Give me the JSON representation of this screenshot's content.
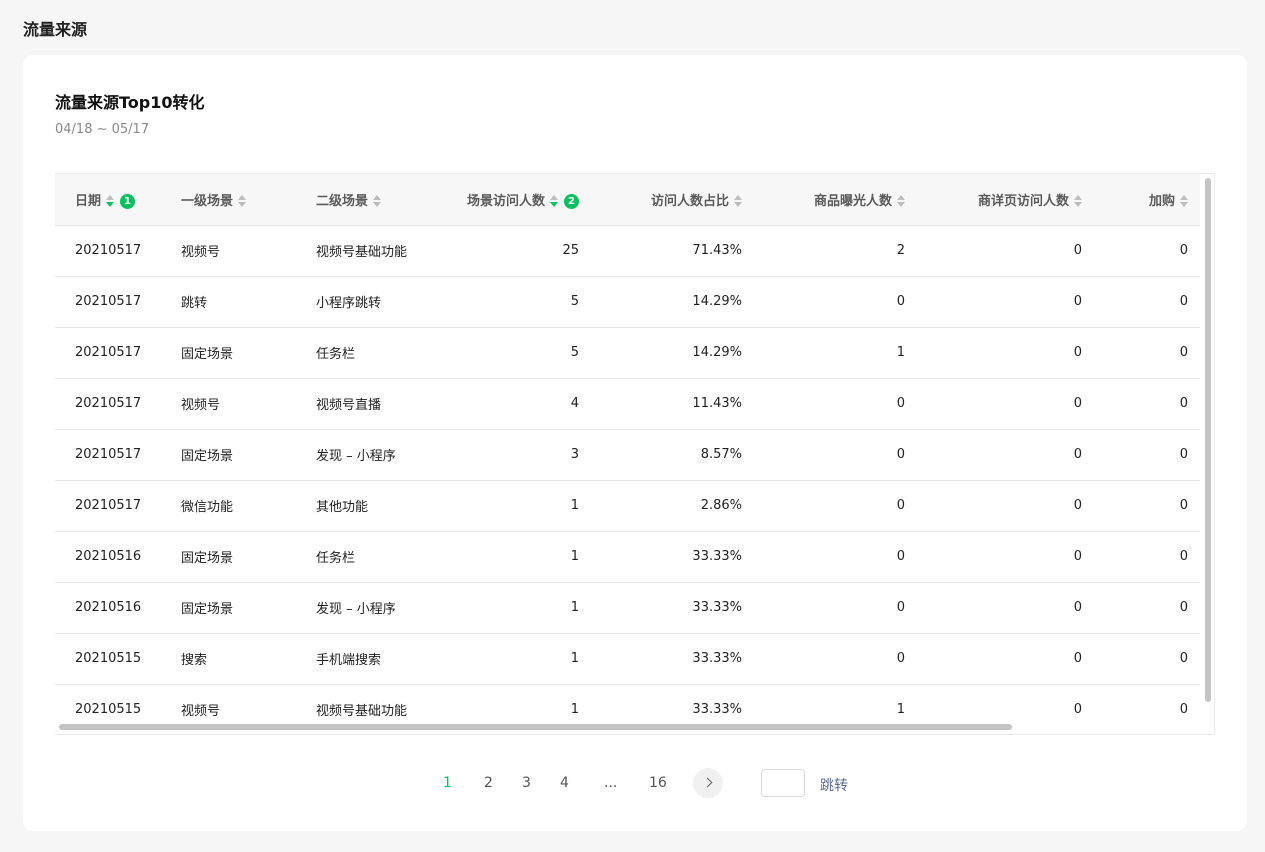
{
  "page": {
    "title": "流量来源"
  },
  "card": {
    "title": "流量来源Top10转化",
    "date_range": "04/18 ~ 05/17"
  },
  "table": {
    "columns": [
      {
        "label": "日期",
        "badge": "1",
        "sorted": "desc"
      },
      {
        "label": "一级场景"
      },
      {
        "label": "二级场景"
      },
      {
        "label": "场景访问人数",
        "badge": "2",
        "sorted": "desc"
      },
      {
        "label": "访问人数占比"
      },
      {
        "label": "商品曝光人数"
      },
      {
        "label": "商详页访问人数"
      },
      {
        "label": "加购"
      }
    ],
    "rows": [
      [
        "20210517",
        "视频号",
        "视频号基础功能",
        "25",
        "71.43%",
        "2",
        "0",
        "0"
      ],
      [
        "20210517",
        "跳转",
        "小程序跳转",
        "5",
        "14.29%",
        "0",
        "0",
        "0"
      ],
      [
        "20210517",
        "固定场景",
        "任务栏",
        "5",
        "14.29%",
        "1",
        "0",
        "0"
      ],
      [
        "20210517",
        "视频号",
        "视频号直播",
        "4",
        "11.43%",
        "0",
        "0",
        "0"
      ],
      [
        "20210517",
        "固定场景",
        "发现 – 小程序",
        "3",
        "8.57%",
        "0",
        "0",
        "0"
      ],
      [
        "20210517",
        "微信功能",
        "其他功能",
        "1",
        "2.86%",
        "0",
        "0",
        "0"
      ],
      [
        "20210516",
        "固定场景",
        "任务栏",
        "1",
        "33.33%",
        "0",
        "0",
        "0"
      ],
      [
        "20210516",
        "固定场景",
        "发现 – 小程序",
        "1",
        "33.33%",
        "0",
        "0",
        "0"
      ],
      [
        "20210515",
        "搜索",
        "手机端搜索",
        "1",
        "33.33%",
        "0",
        "0",
        "0"
      ],
      [
        "20210515",
        "视频号",
        "视频号基础功能",
        "1",
        "33.33%",
        "1",
        "0",
        "0"
      ]
    ]
  },
  "pagination": {
    "pages": [
      "1",
      "2",
      "3",
      "4",
      "...",
      "16"
    ],
    "current": "1",
    "jump_label": "跳转"
  },
  "colors": {
    "accent": "#07c160",
    "link": "#576b95"
  }
}
